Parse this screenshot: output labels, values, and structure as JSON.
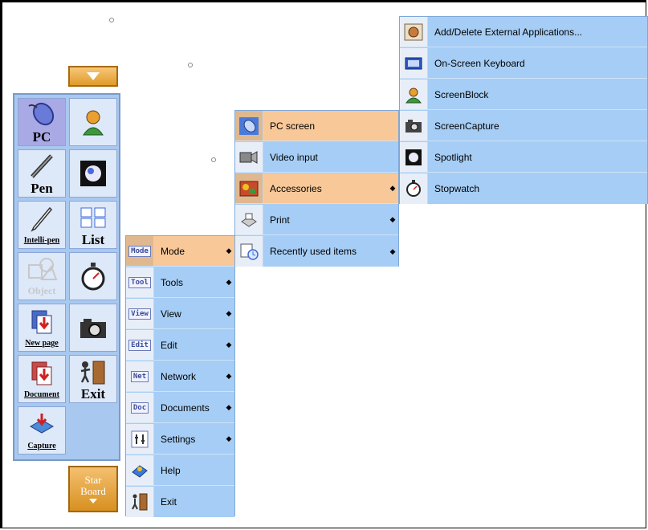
{
  "palette": {
    "tools": [
      {
        "label": "PC",
        "icon": "mouse-icon"
      },
      {
        "label": "",
        "icon": "presenter-icon"
      },
      {
        "label": "Pen",
        "icon": "pen-icon"
      },
      {
        "label": "",
        "icon": "spotlight-icon"
      },
      {
        "label": "Intelli-pen",
        "icon": "intelli-pen-icon"
      },
      {
        "label": "List",
        "icon": "list-icon"
      },
      {
        "label": "Object",
        "icon": "object-icon"
      },
      {
        "label": "",
        "icon": "stopwatch-icon"
      },
      {
        "label": "New page",
        "icon": "new-page-icon"
      },
      {
        "label": "",
        "icon": "camera-icon"
      },
      {
        "label": "Document",
        "icon": "document-icon"
      },
      {
        "label": "Exit",
        "icon": "exit-door-icon"
      },
      {
        "label": "Capture",
        "icon": "capture-icon"
      }
    ],
    "starboard": {
      "line1": "Star",
      "line2": "Board"
    }
  },
  "main_menu": {
    "items": [
      {
        "tag": "Mode",
        "label": "Mode",
        "submenu": true
      },
      {
        "tag": "Tool",
        "label": "Tools",
        "submenu": true
      },
      {
        "tag": "View",
        "label": "View",
        "submenu": true
      },
      {
        "tag": "Edit",
        "label": "Edit",
        "submenu": true
      },
      {
        "tag": "Net",
        "label": "Network",
        "submenu": true
      },
      {
        "tag": "Doc",
        "label": "Documents",
        "submenu": true
      },
      {
        "tag": "",
        "label": "Settings",
        "submenu": true
      },
      {
        "tag": "",
        "label": "Help",
        "submenu": false
      },
      {
        "tag": "",
        "label": "Exit",
        "submenu": false
      }
    ]
  },
  "mode_menu": {
    "items": [
      {
        "label": "PC screen",
        "submenu": false
      },
      {
        "label": "Video input",
        "submenu": false
      },
      {
        "label": "Accessories",
        "submenu": true
      },
      {
        "label": "Print",
        "submenu": true
      },
      {
        "label": "Recently used items",
        "submenu": true
      }
    ]
  },
  "accessories_menu": {
    "items": [
      {
        "label": "Add/Delete External Applications..."
      },
      {
        "label": "On-Screen Keyboard"
      },
      {
        "label": "ScreenBlock"
      },
      {
        "label": "ScreenCapture"
      },
      {
        "label": "Spotlight"
      },
      {
        "label": "Stopwatch"
      }
    ]
  },
  "colors": {
    "menu_bg": "#a6cdf5",
    "highlight": "#f8c898",
    "starboard": "#e09a28"
  }
}
